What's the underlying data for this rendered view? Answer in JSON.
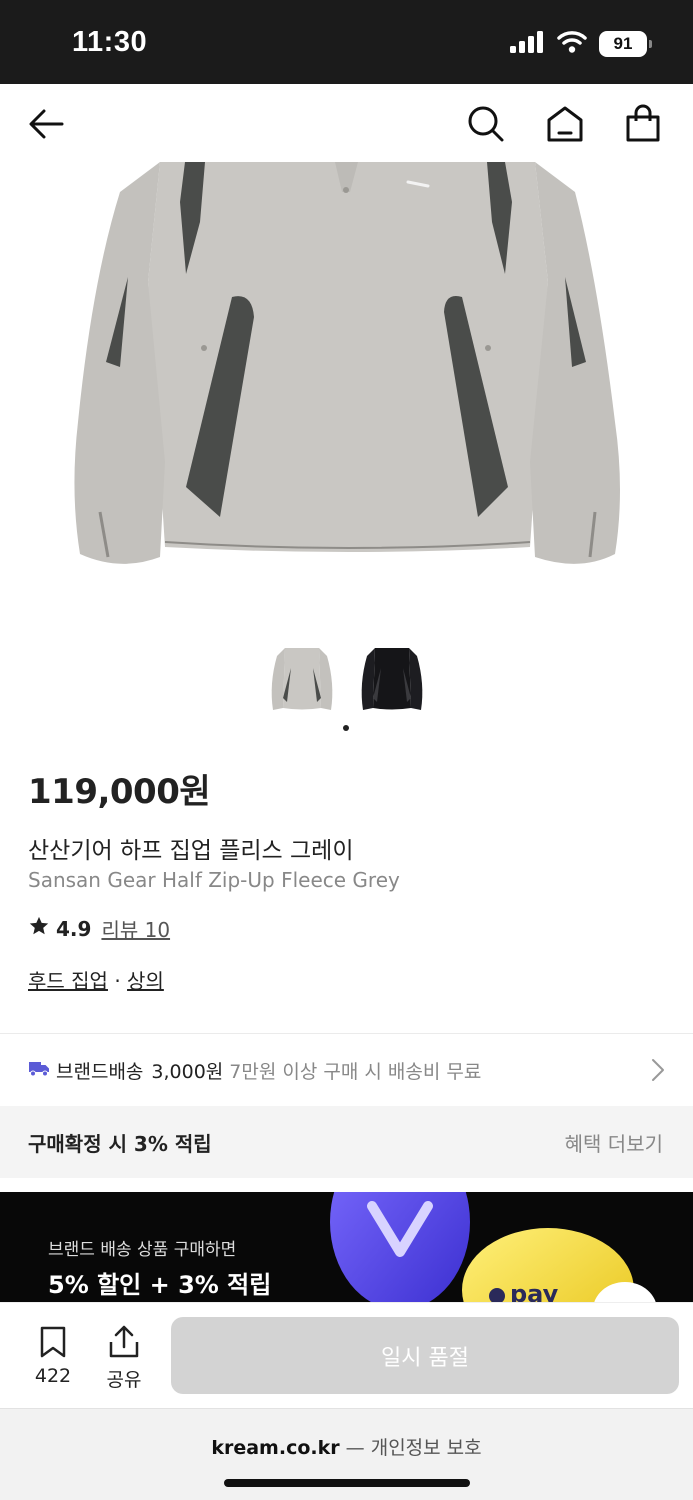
{
  "status_bar": {
    "time": "11:30",
    "battery": "91"
  },
  "product": {
    "price": "119,000원",
    "name_ko": "산산기어 하프 집업 플리스 그레이",
    "name_en": "Sansan Gear Half Zip-Up Fleece Grey",
    "rating": "4.9",
    "review_label": "리뷰 10",
    "category_1": "후드 집업",
    "category_sep": " · ",
    "category_2": "상의"
  },
  "shipping": {
    "title": "브랜드배송",
    "fee": "3,000원",
    "note": "7만원 이상 구매 시 배송비 무료"
  },
  "points": {
    "title": "구매확정 시 3% 적립",
    "more": "혜택 더보기"
  },
  "banner": {
    "line1": "브랜드 배송 상품 구매하면",
    "line2": "5% 할인 + 3% 적립",
    "pay_text": "pay"
  },
  "bottom_bar": {
    "bookmark_count": "422",
    "share_label": "공유",
    "soldout_label": "일시 품절"
  },
  "url_bar": {
    "domain": "kream.co.kr",
    "separator": " — ",
    "privacy": "개인정보 보호"
  },
  "colors": {
    "product_grey": "#c9c7c3",
    "panel_dark": "#4a4c4a",
    "soldout_bg": "#d3d3d3",
    "shipping_icon": "#5b5bd6"
  }
}
